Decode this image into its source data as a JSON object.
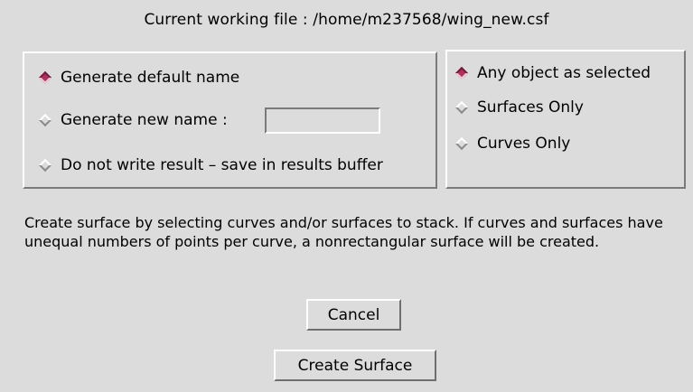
{
  "header": {
    "working_file": "Current working file : /home/m237568/wing_new.csf"
  },
  "naming_options": {
    "items": [
      {
        "label": "Generate default name",
        "selected": true
      },
      {
        "label": "Generate new name :",
        "selected": false
      },
      {
        "label": "Do not write result – save in results buffer",
        "selected": false
      }
    ],
    "new_name_value": ""
  },
  "selection_filter": {
    "items": [
      {
        "label": "Any object as selected",
        "selected": true
      },
      {
        "label": "Surfaces Only",
        "selected": false
      },
      {
        "label": "Curves Only",
        "selected": false
      }
    ]
  },
  "description": "Create surface by selecting curves and/or surfaces  to stack.  If curves and surfaces have unequal numbers of points per  curve, a nonrectangular surface will be created.",
  "buttons": {
    "cancel_label": "Cancel",
    "create_label": "Create Surface"
  },
  "colors": {
    "background": "#dcdcdc",
    "radio_selected": "#b03060"
  }
}
